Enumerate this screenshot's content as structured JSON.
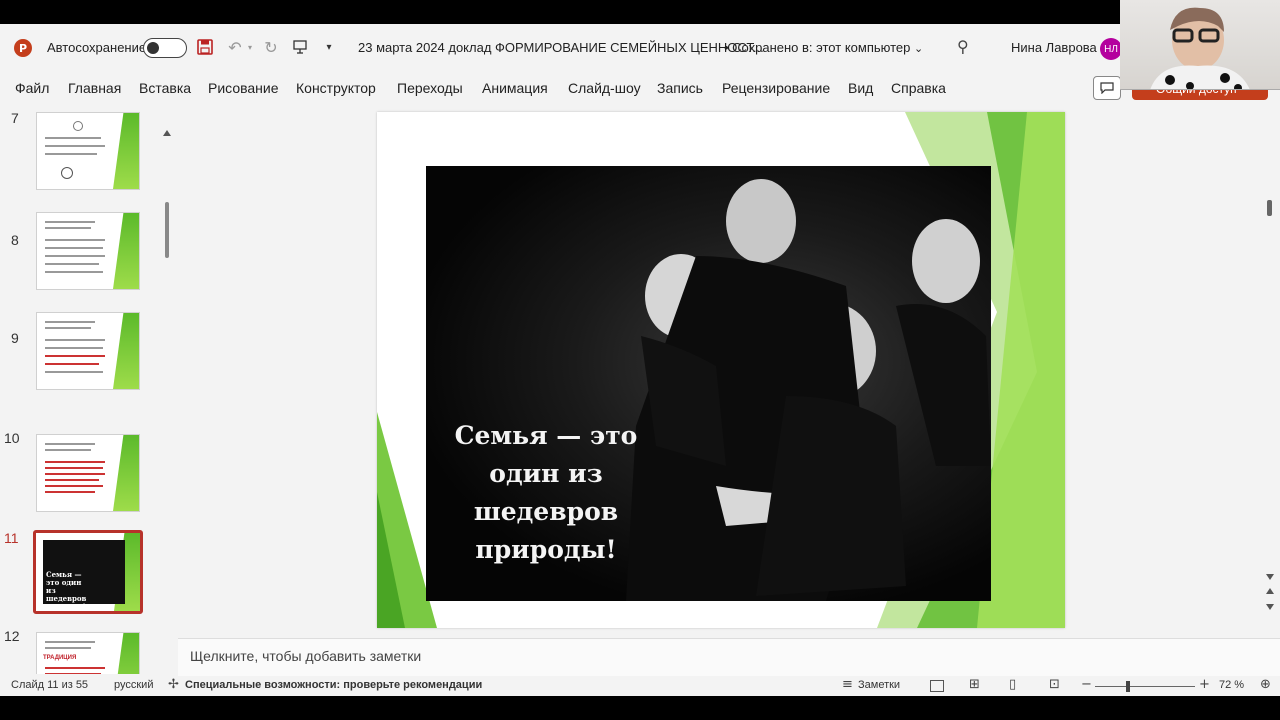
{
  "titlebar": {
    "app_logo": "P",
    "autosave_label": "Автосохранение",
    "doc_title": "23 марта 2024 доклад ФОРМИРОВАНИЕ СЕМЕЙНЫХ ЦЕННОСТ...",
    "save_state": "• Сохранено в: этот компьютер",
    "user_name": "Нина Лаврова",
    "user_initials": "НЛ"
  },
  "menu": [
    "Файл",
    "Главная",
    "Вставка",
    "Рисование",
    "Конструктор",
    "Переходы",
    "Анимация",
    "Слайд-шоу",
    "Запись",
    "Рецензирование",
    "Вид",
    "Справка"
  ],
  "share_label": "Общий доступ",
  "thumbnails": [
    {
      "number": "7"
    },
    {
      "number": "8"
    },
    {
      "number": "9"
    },
    {
      "number": "10"
    },
    {
      "number": "11",
      "selected": true,
      "text": "Семья — это один из шедевров природы!"
    },
    {
      "number": "12",
      "text": "ТРАДИЦИЯ"
    }
  ],
  "slide": {
    "text_lines": [
      "Семья — это",
      "один из",
      "шедевров",
      "природы!"
    ]
  },
  "notes_placeholder": "Щелкните, чтобы добавить заметки",
  "status": {
    "slide_counter": "Слайд 11 из 55",
    "language": "русский",
    "accessibility": "Специальные возможности: проверьте рекомендации",
    "notes_label": "Заметки",
    "zoom": "72 %"
  },
  "colors": {
    "accent_red": "#c43e1c",
    "selected_border": "#b7322a",
    "slide_green": "#7ac943",
    "avatar": "#b4009e"
  }
}
